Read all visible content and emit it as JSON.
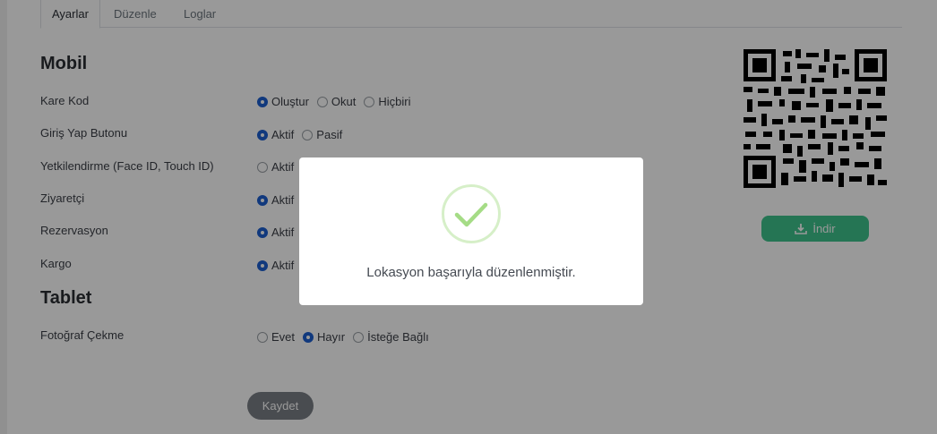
{
  "tabs": [
    {
      "label": "Ayarlar",
      "active": true
    },
    {
      "label": "Düzenle",
      "active": false
    },
    {
      "label": "Loglar",
      "active": false
    }
  ],
  "mobil": {
    "title": "Mobil",
    "rows": [
      {
        "label": "Kare Kod",
        "options": [
          "Oluştur",
          "Okut",
          "Hiçbiri"
        ],
        "selected": "Oluştur"
      },
      {
        "label": "Giriş Yap Butonu",
        "options": [
          "Aktif",
          "Pasif"
        ],
        "selected": "Aktif"
      },
      {
        "label": "Yetkilendirme (Face ID, Touch ID)",
        "options": [
          "Aktif"
        ],
        "selected": null
      },
      {
        "label": "Ziyaretçi",
        "options": [
          "Aktif"
        ],
        "selected": "Aktif"
      },
      {
        "label": "Rezervasyon",
        "options": [
          "Aktif"
        ],
        "selected": "Aktif"
      },
      {
        "label": "Kargo",
        "options": [
          "Aktif"
        ],
        "selected": "Aktif"
      }
    ]
  },
  "tablet": {
    "title": "Tablet",
    "rows": [
      {
        "label": "Fotoğraf Çekme",
        "options": [
          "Evet",
          "Hayır",
          "İsteğe Bağlı"
        ],
        "selected": "Hayır"
      }
    ]
  },
  "download_label": "İndir",
  "save_label": "Kaydet",
  "modal": {
    "message": "Lokasyon başarıyla düzenlenmiştir.",
    "icon": "check-icon"
  },
  "colors": {
    "radio_selected": "#1d5fd1",
    "download_button": "#3ec48c",
    "success_check": "#a5dc86",
    "overlay": "rgba(0,0,0,0.4)"
  }
}
